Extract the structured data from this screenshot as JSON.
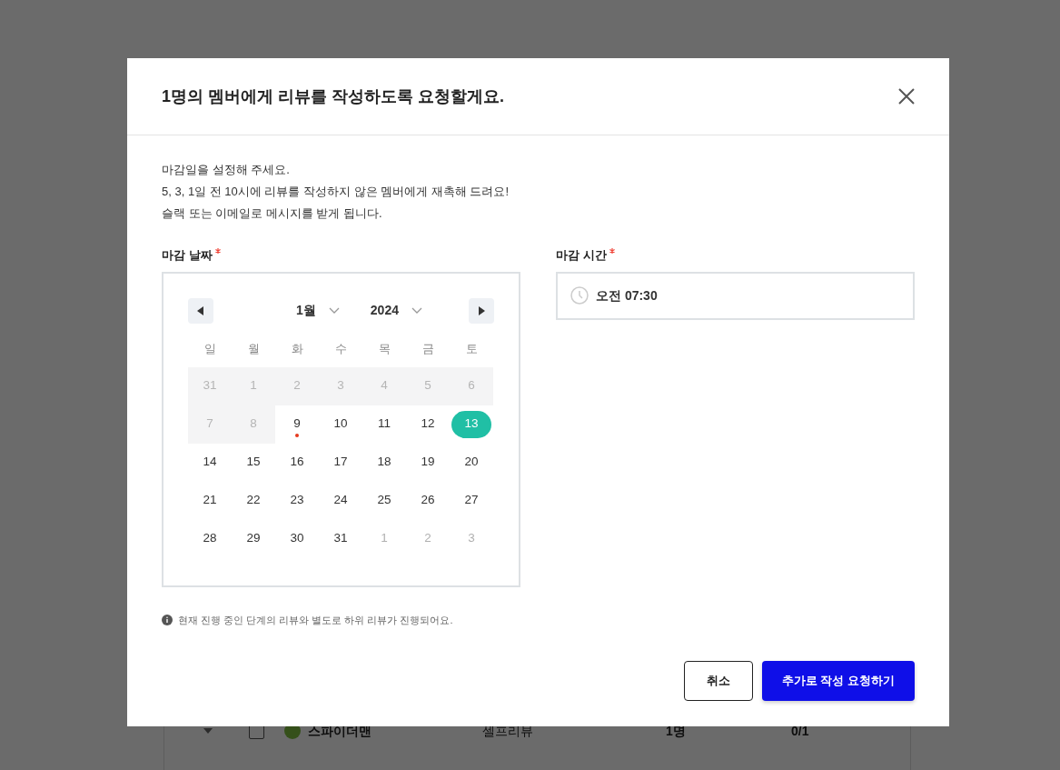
{
  "background": {
    "rows": [
      {
        "name": "스파이더맨",
        "type": "셀프리뷰",
        "count": "1명",
        "progress": "0/1",
        "checked": false
      }
    ]
  },
  "dialog": {
    "title": "1명의 멤버에게 리뷰를 작성하도록 요청할게요.",
    "intro": [
      "마감일을 설정해 주세요.",
      "5, 3, 1일 전 10시에 리뷰를 작성하지 않은 멤버에게 재촉해 드려요!",
      "슬랙 또는 이메일로 메시지를 받게 됩니다."
    ],
    "date_field": {
      "label": "마감 날짜",
      "required": true,
      "month": "1월",
      "year": "2024",
      "weekdays": [
        "일",
        "월",
        "화",
        "수",
        "목",
        "금",
        "토"
      ],
      "weeks": [
        [
          {
            "label": "31",
            "kind": "disabled",
            "selected": false,
            "today": false
          },
          {
            "label": "1",
            "kind": "disabled",
            "selected": false,
            "today": false
          },
          {
            "label": "2",
            "kind": "disabled",
            "selected": false,
            "today": false
          },
          {
            "label": "3",
            "kind": "disabled",
            "selected": false,
            "today": false
          },
          {
            "label": "4",
            "kind": "disabled",
            "selected": false,
            "today": false
          },
          {
            "label": "5",
            "kind": "disabled",
            "selected": false,
            "today": false
          },
          {
            "label": "6",
            "kind": "disabled",
            "selected": false,
            "today": false
          }
        ],
        [
          {
            "label": "7",
            "kind": "disabled",
            "selected": false,
            "today": false
          },
          {
            "label": "8",
            "kind": "disabled",
            "selected": false,
            "today": false
          },
          {
            "label": "9",
            "kind": "normal",
            "selected": false,
            "today": true
          },
          {
            "label": "10",
            "kind": "normal",
            "selected": false,
            "today": false
          },
          {
            "label": "11",
            "kind": "normal",
            "selected": false,
            "today": false
          },
          {
            "label": "12",
            "kind": "normal",
            "selected": false,
            "today": false
          },
          {
            "label": "13",
            "kind": "normal",
            "selected": true,
            "today": false
          }
        ],
        [
          {
            "label": "14",
            "kind": "normal",
            "selected": false,
            "today": false
          },
          {
            "label": "15",
            "kind": "normal",
            "selected": false,
            "today": false
          },
          {
            "label": "16",
            "kind": "normal",
            "selected": false,
            "today": false
          },
          {
            "label": "17",
            "kind": "normal",
            "selected": false,
            "today": false
          },
          {
            "label": "18",
            "kind": "normal",
            "selected": false,
            "today": false
          },
          {
            "label": "19",
            "kind": "normal",
            "selected": false,
            "today": false
          },
          {
            "label": "20",
            "kind": "normal",
            "selected": false,
            "today": false
          }
        ],
        [
          {
            "label": "21",
            "kind": "normal",
            "selected": false,
            "today": false
          },
          {
            "label": "22",
            "kind": "normal",
            "selected": false,
            "today": false
          },
          {
            "label": "23",
            "kind": "normal",
            "selected": false,
            "today": false
          },
          {
            "label": "24",
            "kind": "normal",
            "selected": false,
            "today": false
          },
          {
            "label": "25",
            "kind": "normal",
            "selected": false,
            "today": false
          },
          {
            "label": "26",
            "kind": "normal",
            "selected": false,
            "today": false
          },
          {
            "label": "27",
            "kind": "normal",
            "selected": false,
            "today": false
          }
        ],
        [
          {
            "label": "28",
            "kind": "normal",
            "selected": false,
            "today": false
          },
          {
            "label": "29",
            "kind": "normal",
            "selected": false,
            "today": false
          },
          {
            "label": "30",
            "kind": "normal",
            "selected": false,
            "today": false
          },
          {
            "label": "31",
            "kind": "normal",
            "selected": false,
            "today": false
          },
          {
            "label": "1",
            "kind": "outside",
            "selected": false,
            "today": false
          },
          {
            "label": "2",
            "kind": "outside",
            "selected": false,
            "today": false
          },
          {
            "label": "3",
            "kind": "outside",
            "selected": false,
            "today": false
          }
        ]
      ]
    },
    "time_field": {
      "label": "마감 시간",
      "required": true,
      "value": "오전 07:30"
    },
    "note": "현재 진행 중인 단계의 리뷰와 별도로 하위 리뷰가 진행되어요.",
    "buttons": [
      {
        "label": "취소",
        "kind": "secondary"
      },
      {
        "label": "추가로 작성 요청하기",
        "kind": "primary"
      }
    ]
  }
}
